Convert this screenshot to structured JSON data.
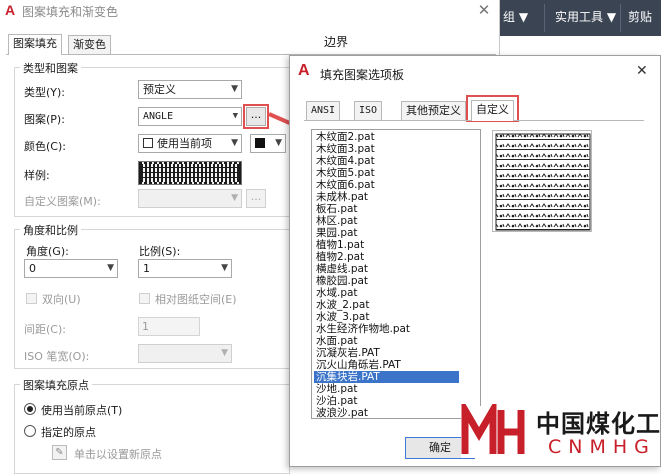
{
  "main_dialog": {
    "title": "图案填充和渐变色",
    "close_glyph": "✕",
    "tabs": [
      "图案填充",
      "渐变色"
    ],
    "type_group": {
      "title": "类型和图案",
      "type_label": "类型(Y):",
      "type_value": "预定义",
      "pattern_label": "图案(P):",
      "pattern_value": "ANGLE",
      "browse_label": "...",
      "color_label": "颜色(C):",
      "color_value": "使用当前项",
      "sample_label": "样例:",
      "custom_label": "自定义图案(M):",
      "custom_browse": "..."
    },
    "angle_group": {
      "title": "角度和比例",
      "angle_label": "角度(G):",
      "angle_value": "0",
      "scale_label": "比例(S):",
      "scale_value": "1",
      "double_label": "双向(U)",
      "relative_label": "相对图纸空间(E)",
      "spacing_label": "间距(C):",
      "spacing_value": "1",
      "iso_label": "ISO 笔宽(O):"
    },
    "origin_group": {
      "title": "图案填充原点",
      "use_current": "使用当前原点(T)",
      "specified": "指定的原点",
      "click_set": "单击以设置新原点"
    },
    "boundary_label": "边界"
  },
  "toolbar": {
    "items": [
      "组",
      "实用工具",
      "剪贴"
    ]
  },
  "palette": {
    "title": "填充图案选项板",
    "close_glyph": "✕",
    "tabs": [
      "ANSI",
      "ISO",
      "其他预定义",
      "自定义"
    ],
    "active_tab": "自定义",
    "items": [
      "木纹面2.pat",
      "木纹面3.pat",
      "木纹面4.pat",
      "木纹面5.pat",
      "木纹面6.pat",
      "未成林.pat",
      "板石.pat",
      "林区.pat",
      "果园.pat",
      "植物1.pat",
      "植物2.pat",
      "横虚线.pat",
      "橡胶园.pat",
      "水域.pat",
      "水波_2.pat",
      "水波_3.pat",
      "水生经济作物地.pat",
      "水面.pat",
      "沉凝灰岩.PAT",
      "沉火山角砾岩.PAT",
      "沉集块岩.PAT",
      "沙地.pat",
      "沙泊.pat",
      "波浪沙.pat"
    ],
    "selected_index": 20,
    "ok_label": "确定"
  },
  "logo": {
    "cn": "中国煤化工",
    "en": "CNMHG",
    "brand_color": "#c8202a"
  },
  "colors": {
    "highlight": "#e05050",
    "selection": "#3b74c9",
    "toolbar_bg": "#3b4453"
  }
}
